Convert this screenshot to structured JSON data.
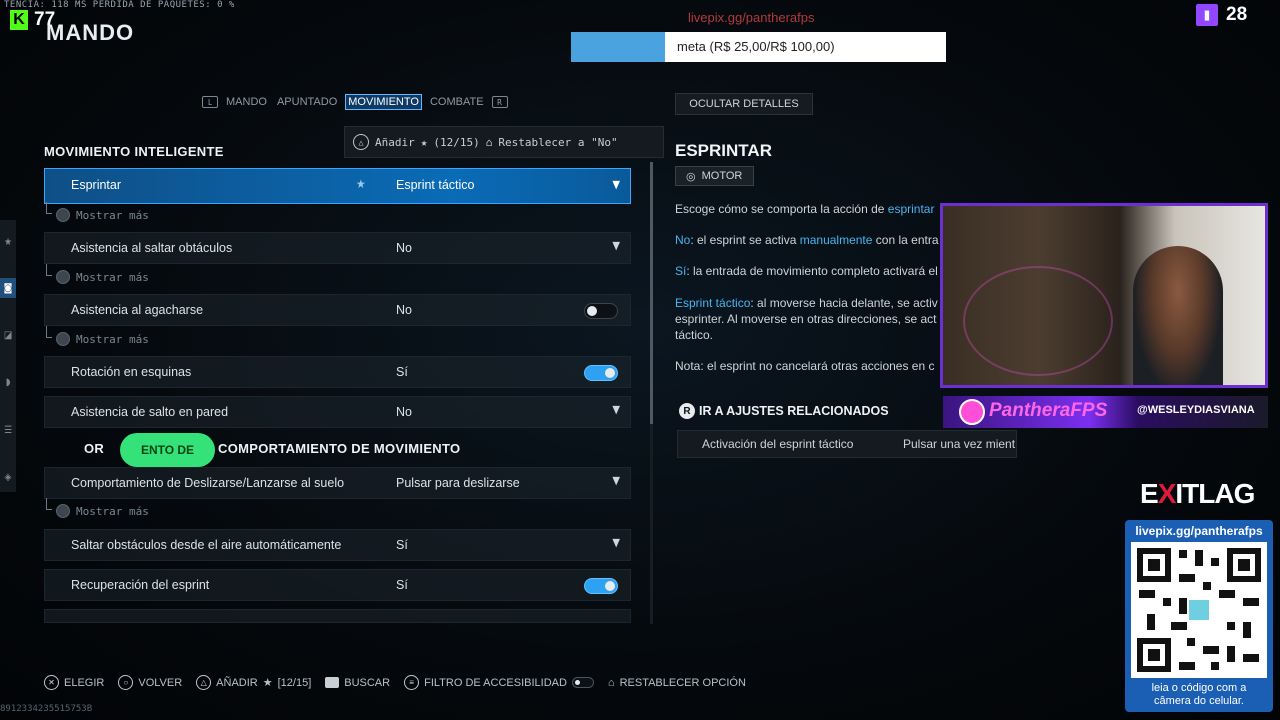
{
  "stream": {
    "ping_text": "TENCIA: 118 MS   PÉRDIDA DE PAQUETES:  0 %",
    "kick_count": "77",
    "twitch_count": "28",
    "donate_url": "livepix.gg/pantherafps",
    "goal_text": "meta (R$ 25,00/R$ 100,00)",
    "goal_progress": 0.25
  },
  "header": {
    "title": "MANDO"
  },
  "tabs": [
    "MANDO",
    "APUNTADO",
    "MOVIMIENTO",
    "COMBATE"
  ],
  "active_tab": "MOVIMIENTO",
  "favorites_bar": {
    "add_label": "Añadir",
    "count": "(12/15)",
    "reset_label": "Restablecer a \"No\""
  },
  "section_smart": {
    "title": "MOVIMIENTO INTELIGENTE"
  },
  "show_more": "Mostrar más",
  "rows": [
    {
      "label": "Esprintar",
      "value": "Esprint táctico",
      "control": "dropdown"
    },
    {
      "label": "Asistencia al saltar obtáculos",
      "value": "No",
      "control": "dropdown"
    },
    {
      "label": "Asistencia al agacharse",
      "value": "No",
      "control": "toggle-off"
    },
    {
      "label": "Rotación en esquinas",
      "value": "Sí",
      "control": "toggle-on"
    },
    {
      "label": "Asistencia de salto en pared",
      "value": "No",
      "control": "dropdown"
    }
  ],
  "section_behavior": {
    "title": "COMPORTAMIENTO DE MOVIMIENTO",
    "prefix": "OR",
    "badge": "ENTO DE"
  },
  "rows2": [
    {
      "label": "Comportamiento de Deslizarse/Lanzarse al suelo",
      "value": "Pulsar para deslizarse",
      "control": "dropdown"
    },
    {
      "label": "Saltar obstáculos desde el aire automáticamente",
      "value": "Sí",
      "control": "dropdown"
    },
    {
      "label": "Recuperación del esprint",
      "value": "Sí",
      "control": "toggle-on"
    }
  ],
  "details": {
    "hide_button": "OCULTAR DETALLES",
    "title": "ESPRINTAR",
    "category": "MOTOR",
    "line1_a": "Escoge cómo se comporta la acción de ",
    "line1_hl": "esprintar",
    "line2_hl": "No",
    "line2_a": ": el esprint se activa ",
    "line2_hl2": "manualmente",
    "line2_b": " con la entra",
    "line3_hl": "Sí",
    "line3_a": ": la entrada de movimiento completo activará el",
    "line4_hl": "Esprint táctico",
    "line4_a": ": al moverse hacia delante, se activ",
    "line5": "esprinter. Al moverse en otras direcciones, se act",
    "line6": "táctico.",
    "note_label": "Nota",
    "note_text": ": el esprint no cancelará otras acciones en c",
    "related_title": "IR A AJUSTES RELACIONADOS",
    "related_label": "Activación del esprint táctico",
    "related_value": "Pulsar una vez mient"
  },
  "overlay": {
    "brand_name": "PantheraFPS",
    "handle": "@WESLEYDIASVIANA",
    "sponsor_prefix": "E",
    "sponsor_x": "X",
    "sponsor_rest": "ITLAG",
    "qr_url": "livepix.gg/pantherafps",
    "qr_caption_1": "leia o código com a",
    "qr_caption_2": "câmera do celular."
  },
  "footer": {
    "choose": "ELEGIR",
    "back": "VOLVER",
    "add": "AÑADIR",
    "add_count": "[12/15]",
    "search": "BUSCAR",
    "accessibility": "FILTRO DE ACCESIBILIDAD",
    "reset": "RESTABLECER OPCIÓN",
    "build_id": "8912334235515753B"
  },
  "colors": {
    "accent": "#3fa4ff",
    "selected_row": "#0a6bb6",
    "highlight_text": "#45b4f0",
    "twitch": "#9147ff",
    "kick": "#53fc18"
  }
}
